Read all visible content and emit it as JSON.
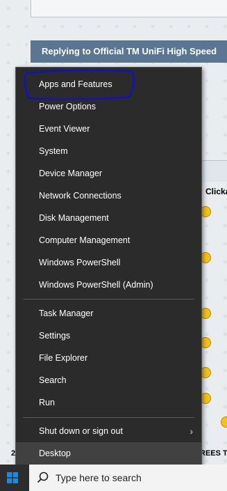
{
  "background": {
    "header_title": "Replying to Official TM UniFi High Speed",
    "clickable_text": "Clicka",
    "left_number": "2",
    "right_text": "REES T"
  },
  "menu": {
    "items": [
      {
        "label": "Apps and Features"
      },
      {
        "label": "Power Options"
      },
      {
        "label": "Event Viewer"
      },
      {
        "label": "System"
      },
      {
        "label": "Device Manager"
      },
      {
        "label": "Network Connections"
      },
      {
        "label": "Disk Management"
      },
      {
        "label": "Computer Management"
      },
      {
        "label": "Windows PowerShell"
      },
      {
        "label": "Windows PowerShell (Admin)"
      },
      {
        "label": "Task Manager"
      },
      {
        "label": "Settings"
      },
      {
        "label": "File Explorer"
      },
      {
        "label": "Search"
      },
      {
        "label": "Run"
      },
      {
        "label": "Shut down or sign out"
      },
      {
        "label": "Desktop"
      }
    ],
    "highlighted": "Desktop",
    "annotation_color": "#1010c8"
  },
  "taskbar": {
    "search_placeholder": "Type here to search",
    "start_color": "#1e88e5"
  }
}
